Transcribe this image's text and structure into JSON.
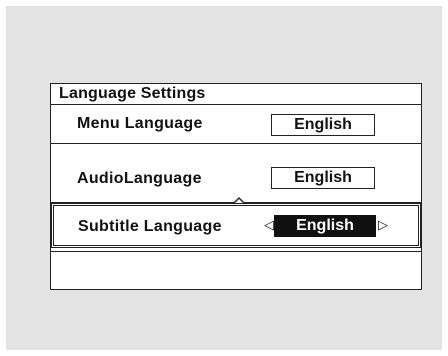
{
  "dialog": {
    "title": "Language Settings",
    "rows": [
      {
        "label": "Menu Language",
        "value": "English"
      },
      {
        "label": "AudioLanguage",
        "value": "English"
      },
      {
        "label": "Subtitle Language",
        "value": "English",
        "left_arrow": "◁",
        "right_arrow": "▷"
      }
    ]
  }
}
